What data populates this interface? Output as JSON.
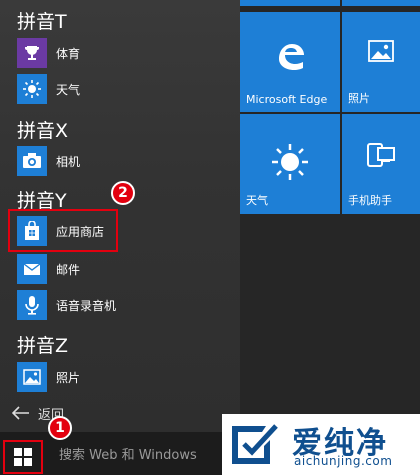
{
  "app_list": {
    "groups": [
      {
        "header": "拼音T",
        "apps": [
          {
            "label": "体育",
            "icon": "trophy-icon",
            "color": "#6b3aa3"
          },
          {
            "label": "天气",
            "icon": "sun-icon",
            "color": "#1e7fd6"
          }
        ]
      },
      {
        "header": "拼音X",
        "apps": [
          {
            "label": "相机",
            "icon": "camera-icon",
            "color": "#1e7fd6"
          }
        ]
      },
      {
        "header": "拼音Y",
        "apps": [
          {
            "label": "应用商店",
            "icon": "store-bag-icon",
            "color": "#1e7fd6"
          },
          {
            "label": "邮件",
            "icon": "mail-icon",
            "color": "#1e7fd6"
          },
          {
            "label": "语音录音机",
            "icon": "microphone-icon",
            "color": "#1e7fd6"
          }
        ]
      },
      {
        "header": "拼音Z",
        "apps": [
          {
            "label": "照片",
            "icon": "photo-icon",
            "color": "#1e7fd6"
          }
        ]
      }
    ],
    "back_label": "返回"
  },
  "annotations": {
    "step1": "1",
    "step2": "2",
    "accent": "#e3000f"
  },
  "tiles": [
    {
      "label": "Microsoft Edge",
      "icon": "edge-icon"
    },
    {
      "label": "照片",
      "icon": "photo-icon"
    },
    {
      "label": "天气",
      "icon": "sun-icon"
    },
    {
      "label": "手机助手",
      "icon": "phone-companion-icon"
    }
  ],
  "taskbar": {
    "search_placeholder": "搜索 Web 和 Windows",
    "start_icon": "windows-logo-icon"
  },
  "watermark": {
    "brand": "爱纯净",
    "url": "aichunjing.com"
  }
}
